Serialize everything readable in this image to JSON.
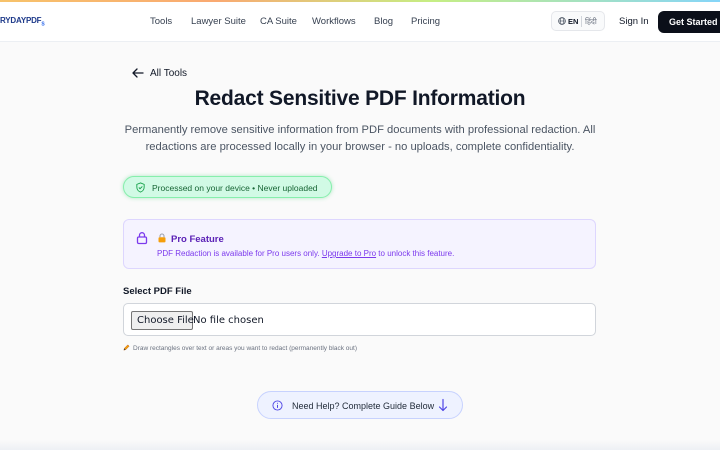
{
  "header": {
    "logo_text": "RYDAYPDF",
    "logo_sub": "S",
    "nav": [
      "Tools",
      "Lawyer Suite",
      "CA Suite",
      "Workflows",
      "Blog",
      "Pricing"
    ],
    "lang_en": "EN",
    "lang_hi": "हिंदी",
    "signin": "Sign In",
    "cta": "Get Started"
  },
  "back_label": "All Tools",
  "title": "Redact Sensitive PDF Information",
  "description": "Permanently remove sensitive information from PDF documents with professional redaction. All redactions are processed locally in your browser - no uploads, complete confidentiality.",
  "privacy_badge": "Processed on your device • Never uploaded",
  "pro": {
    "title": "Pro Feature",
    "body_before": "PDF Redaction is available for Pro users only. ",
    "link": "Upgrade to Pro",
    "body_after": " to unlock this feature."
  },
  "file": {
    "label": "Select PDF File",
    "button": "Choose File",
    "status": "No file chosen",
    "hint": "Draw rectangles over text or areas you want to redact (permanently black out)"
  },
  "help_label": "Need Help? Complete Guide Below",
  "colors": {
    "accent_purple": "#7c3aed",
    "badge_green": "#166534",
    "cta_bg": "#0b0f19"
  }
}
